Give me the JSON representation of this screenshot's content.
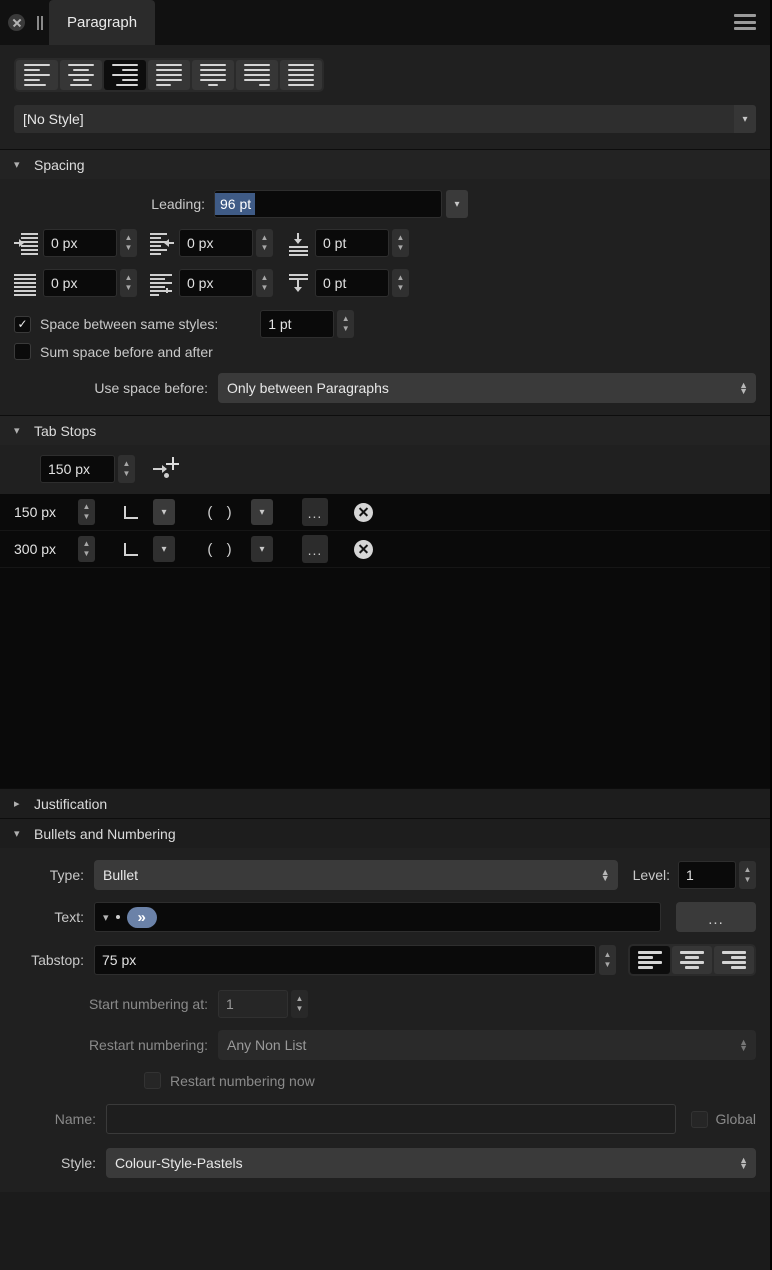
{
  "window": {
    "tab_label": "Paragraph",
    "close_icon": "close-circle-icon",
    "pause_icon": "pause-icon",
    "menu_icon": "hamburger-menu-icon"
  },
  "alignment": {
    "buttons": [
      {
        "name": "align-left",
        "active": false
      },
      {
        "name": "align-center",
        "active": false
      },
      {
        "name": "align-right",
        "active": true
      },
      {
        "name": "align-justify",
        "active": false
      },
      {
        "name": "justify-last-center",
        "active": false
      },
      {
        "name": "justify-last-right",
        "active": false
      },
      {
        "name": "force-justify",
        "active": false
      }
    ],
    "style_dropdown_value": "[No Style]"
  },
  "spacing": {
    "section_label": "Spacing",
    "expanded": true,
    "leading_label": "Leading:",
    "leading_value": "96 pt",
    "leading_selected": true,
    "indent_left_label": "0 px",
    "indent_right_label": "0 px",
    "space_above_label": "0 pt",
    "first_line_label": "0 px",
    "hanging_label": "0 px",
    "space_below_label": "0 pt",
    "space_between_same_styles_label": "Space between same styles:",
    "space_between_same_styles_checked": true,
    "space_between_same_styles_value": "1 pt",
    "sum_space_label": "Sum space before and after",
    "sum_space_checked": false,
    "use_space_before_label": "Use space before:",
    "use_space_before_value": "Only between Paragraphs"
  },
  "tab_stops": {
    "section_label": "Tab Stops",
    "expanded": true,
    "new_value": "150 px",
    "add_icon": "add-tab-stop-icon",
    "rows": [
      {
        "position": "150 px",
        "align_icon": "tab-align-left-icon",
        "fill": "( )",
        "more": "...",
        "delete_icon": "delete-circle-icon"
      },
      {
        "position": "300 px",
        "align_icon": "tab-align-left-icon",
        "fill": "( )",
        "more": "...",
        "delete_icon": "delete-circle-icon"
      }
    ]
  },
  "justification": {
    "section_label": "Justification",
    "expanded": false
  },
  "bullets": {
    "section_label": "Bullets and Numbering",
    "expanded": true,
    "type_label": "Type:",
    "type_value": "Bullet",
    "level_label": "Level:",
    "level_value": "1",
    "text_label": "Text:",
    "text_token_pill": "»",
    "text_more_button": "...",
    "tabstop_label": "Tabstop:",
    "tabstop_value": "75 px",
    "tabstop_align": [
      {
        "name": "bullet-align-left",
        "active": true
      },
      {
        "name": "bullet-align-center",
        "active": false
      },
      {
        "name": "bullet-align-right",
        "active": false
      }
    ],
    "start_numbering_label": "Start numbering at:",
    "start_numbering_value": "1",
    "start_numbering_enabled": false,
    "restart_numbering_label": "Restart numbering:",
    "restart_numbering_value": "Any Non List",
    "restart_numbering_enabled": false,
    "restart_now_label": "Restart numbering now",
    "restart_now_checked": false,
    "name_label": "Name:",
    "name_value": "",
    "name_placeholder": "",
    "global_label": "Global",
    "global_checked": false,
    "style_label": "Style:",
    "style_value": "Colour-Style-Pastels"
  },
  "colors": {
    "accent_selection": "#3f5b86",
    "token_pill": "#6b82a8",
    "panel_bg": "#1b1b1b",
    "field_bg": "#0a0a0a"
  }
}
